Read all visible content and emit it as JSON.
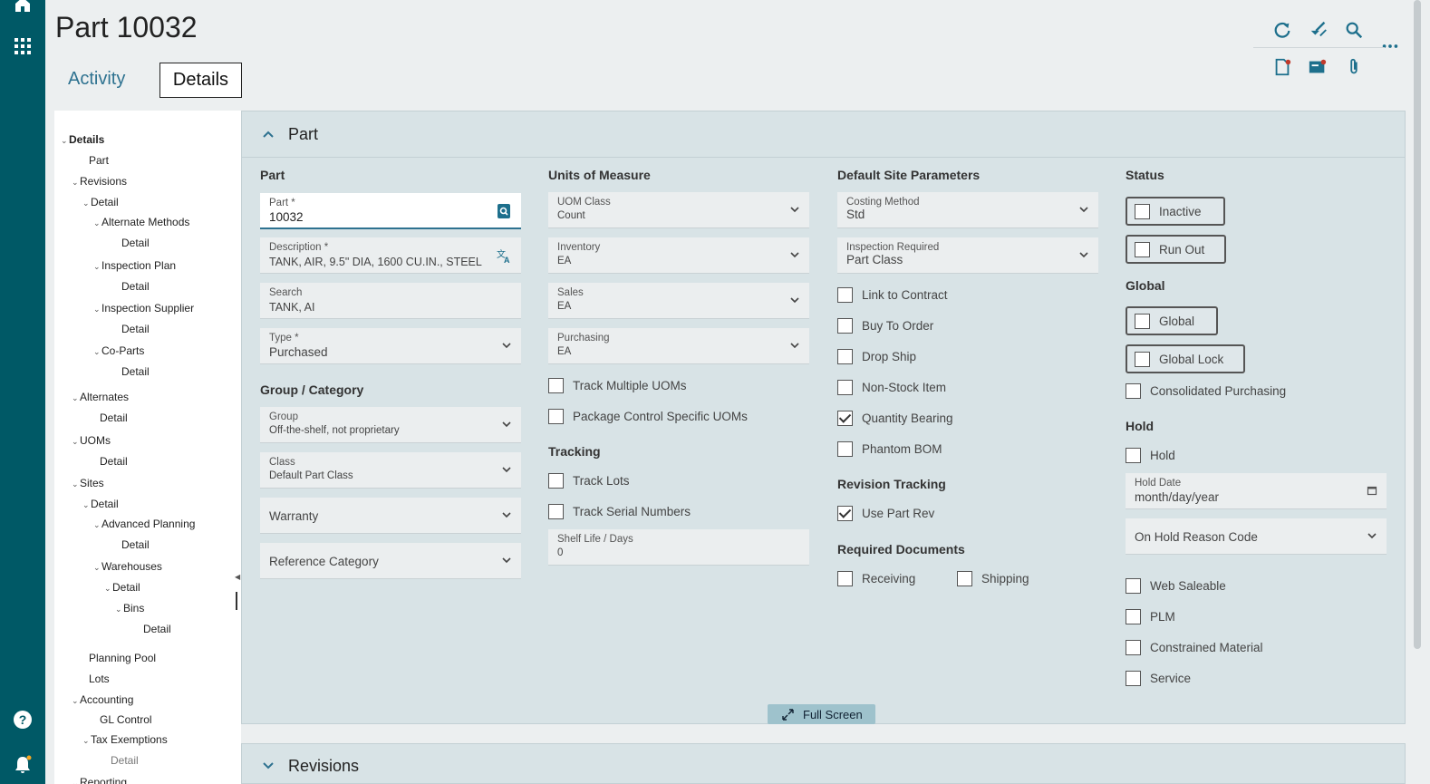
{
  "page": {
    "title": "Part 10032"
  },
  "tabs": {
    "activity": "Activity",
    "details": "Details"
  },
  "tree": [
    {
      "label": "Details",
      "caret": true,
      "bold": true
    },
    {
      "label": "Part"
    },
    {
      "label": "Revisions",
      "caret": true
    },
    {
      "label": "Detail",
      "caret": true
    },
    {
      "label": "Alternate Methods",
      "caret": true
    },
    {
      "label": "Detail"
    },
    {
      "label": "Inspection Plan",
      "caret": true
    },
    {
      "label": "Detail"
    },
    {
      "label": "Inspection Supplier",
      "caret": true
    },
    {
      "label": "Detail"
    },
    {
      "label": "Co-Parts",
      "caret": true
    },
    {
      "label": "Detail"
    },
    {
      "label": "Alternates",
      "caret": true
    },
    {
      "label": "Detail"
    },
    {
      "label": "UOMs",
      "caret": true
    },
    {
      "label": "Detail"
    },
    {
      "label": "Sites",
      "caret": true
    },
    {
      "label": "Detail",
      "caret": true
    },
    {
      "label": "Advanced Planning",
      "caret": true
    },
    {
      "label": "Detail"
    },
    {
      "label": "Warehouses",
      "caret": true
    },
    {
      "label": "Detail",
      "caret": true
    },
    {
      "label": "Bins",
      "caret": true
    },
    {
      "label": "Detail"
    },
    {
      "label": "Planning Pool"
    },
    {
      "label": "Lots"
    },
    {
      "label": "Accounting",
      "caret": true
    },
    {
      "label": "GL Control"
    },
    {
      "label": "Tax Exemptions",
      "caret": true
    },
    {
      "label": "Detail",
      "muted": true
    },
    {
      "label": "Reporting",
      "caret": true
    }
  ],
  "panel": {
    "title": "Part",
    "sections": {
      "part": "Part",
      "group_category": "Group / Category",
      "uom": "Units of Measure",
      "tracking": "Tracking",
      "default_site": "Default Site Parameters",
      "revision_tracking": "Revision Tracking",
      "required_docs": "Required Documents",
      "status": "Status",
      "global": "Global",
      "hold": "Hold"
    },
    "fields": {
      "part": {
        "label": "Part *",
        "value": "10032"
      },
      "description": {
        "label": "Description *",
        "value": "TANK, AIR, 9.5\" DIA, 1600 CU.IN., STEEL"
      },
      "search": {
        "label": "Search",
        "value": "TANK, AI"
      },
      "type": {
        "label": "Type *",
        "value": "Purchased"
      },
      "group": {
        "label": "Group",
        "value": "Off-the-shelf, not proprietary"
      },
      "class": {
        "label": "Class",
        "value": "Default Part Class"
      },
      "warranty": {
        "label": "Warranty"
      },
      "reference_category": {
        "label": "Reference Category"
      },
      "uom_class": {
        "label": "UOM Class",
        "value": "Count"
      },
      "inventory": {
        "label": "Inventory",
        "value": "EA"
      },
      "sales": {
        "label": "Sales",
        "value": "EA"
      },
      "purchasing": {
        "label": "Purchasing",
        "value": "EA"
      },
      "shelf_life": {
        "label": "Shelf Life / Days",
        "value": "0"
      },
      "costing_method": {
        "label": "Costing Method",
        "value": "Std"
      },
      "inspection_required": {
        "label": "Inspection Required",
        "value": "Part Class"
      },
      "hold_date": {
        "label": "Hold Date",
        "value": "month/day/year"
      },
      "on_hold_reason": {
        "label": "On Hold Reason Code"
      }
    },
    "checkboxes": {
      "track_multiple_uoms": {
        "label": "Track Multiple UOMs",
        "checked": false
      },
      "package_control": {
        "label": "Package Control Specific UOMs",
        "checked": false
      },
      "track_lots": {
        "label": "Track Lots",
        "checked": false
      },
      "track_serial": {
        "label": "Track Serial Numbers",
        "checked": false
      },
      "link_to_contract": {
        "label": "Link to Contract",
        "checked": false
      },
      "buy_to_order": {
        "label": "Buy To Order",
        "checked": false
      },
      "drop_ship": {
        "label": "Drop Ship",
        "checked": false
      },
      "non_stock": {
        "label": "Non-Stock Item",
        "checked": false
      },
      "quantity_bearing": {
        "label": "Quantity Bearing",
        "checked": true
      },
      "phantom_bom": {
        "label": "Phantom BOM",
        "checked": false
      },
      "use_part_rev": {
        "label": "Use Part Rev",
        "checked": true
      },
      "receiving": {
        "label": "Receiving",
        "checked": false
      },
      "shipping": {
        "label": "Shipping",
        "checked": false
      },
      "consolidated_purchasing": {
        "label": "Consolidated Purchasing",
        "checked": false
      },
      "hold": {
        "label": "Hold",
        "checked": false
      },
      "web_saleable": {
        "label": "Web Saleable",
        "checked": false
      },
      "plm": {
        "label": "PLM",
        "checked": false
      },
      "constrained_material": {
        "label": "Constrained Material",
        "checked": false
      },
      "service": {
        "label": "Service",
        "checked": false
      }
    },
    "toggles": {
      "inactive": "Inactive",
      "run_out": "Run Out",
      "global": "Global",
      "global_lock": "Global Lock"
    },
    "full_screen": "Full Screen"
  },
  "panel2": {
    "title": "Revisions"
  },
  "colors": {
    "rail": "#005966",
    "accent": "#2e7290",
    "panel": "#d8e3e6"
  }
}
